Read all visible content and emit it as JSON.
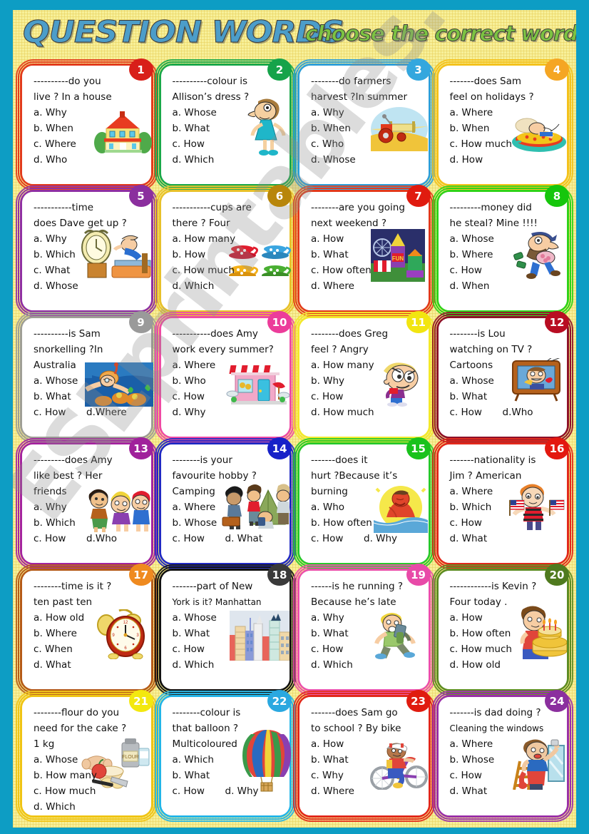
{
  "page": {
    "title_main": "QUESTION WORDS",
    "title_sub": "choose the correct word",
    "watermark": "ESLprintables.com",
    "background_color": "#0d9dc4",
    "sheet_color": "#f7f09a",
    "title_main_color": "#4c9dc9",
    "title_sub_color": "#7cc242"
  },
  "cards": [
    {
      "number": "1",
      "badge_color": "#d81f19",
      "border_color": "#e23a1c",
      "lines": [
        "----------do you",
        "live ?  In a house"
      ],
      "options": [
        "a. Why",
        "b. When",
        "c. Where",
        "d. Who"
      ],
      "art": "house-icon"
    },
    {
      "number": "2",
      "badge_color": "#16a34a",
      "border_color": "#1aa84a",
      "lines": [
        "----------colour is",
        "Allison’s dress ?"
      ],
      "options": [
        "a. Whose",
        "b. What",
        "c. How",
        "d. Which"
      ],
      "art": "woman-dress-icon"
    },
    {
      "number": "3",
      "badge_color": "#34a7de",
      "border_color": "#2f9fd8",
      "lines": [
        "--------do farmers",
        "harvest ?In summer"
      ],
      "options": [
        "a. Why",
        "b. When",
        "c. Who",
        "d. Whose"
      ],
      "art": "tractor-icon"
    },
    {
      "number": "4",
      "badge_color": "#f5a623",
      "border_color": "#f4c21c",
      "lines": [
        "-------does Sam",
        "feel on holidays ?"
      ],
      "options": [
        "a. Where",
        "b. When",
        "c. How much",
        "d. How"
      ],
      "art": "sunbathing-icon"
    },
    {
      "number": "5",
      "badge_color": "#8b2f9e",
      "border_color": "#8f2fa3",
      "lines": [
        "-----------time",
        "does Dave get up ?"
      ],
      "options": [
        "a. Why",
        "b. Which",
        "c. What",
        "d. Whose"
      ],
      "art": "alarm-bed-icon"
    },
    {
      "number": "6",
      "badge_color": "#b8860b",
      "border_color": "#e8c12a",
      "lines": [
        "-----------cups are",
        "there ? Four"
      ],
      "options": [
        "a. How many",
        "b. How",
        "c. How much",
        "d. Which"
      ],
      "art": "cups-icon"
    },
    {
      "number": "7",
      "badge_color": "#e01b0f",
      "border_color": "#e23a1c",
      "lines": [
        "--------are you going",
        "next weekend ?"
      ],
      "options": [
        "a. How",
        "b. What",
        "c. How often",
        "d. Where"
      ],
      "art": "funfair-icon"
    },
    {
      "number": "8",
      "badge_color": "#16c60c",
      "border_color": "#2fd318",
      "lines": [
        "---------money did",
        "he steal? Mine !!!!"
      ],
      "options": [
        "a. Whose",
        "b. Where",
        "c. How",
        "d. When"
      ],
      "art": "thief-icon"
    },
    {
      "number": "9",
      "badge_color": "#9a9a9a",
      "border_color": "#9e9e96",
      "lines": [
        "----------is Sam",
        "snorkelling ?In",
        "Australia"
      ],
      "options": [
        "a. Whose",
        "b. What"
      ],
      "option_pair": [
        "c. How",
        "d.Where"
      ],
      "art": "snorkelling-icon"
    },
    {
      "number": "10",
      "badge_color": "#ec3c9a",
      "border_color": "#ef4aa4",
      "lines": [
        "-----------does Amy",
        "work every summer?"
      ],
      "options": [
        "a. Where",
        "b. Who",
        "c. How",
        "d. Why"
      ],
      "art": "shop-icon"
    },
    {
      "number": "11",
      "badge_color": "#f2e510",
      "border_color": "#f3e92b",
      "lines": [
        "--------does Greg",
        "feel ? Angry"
      ],
      "options": [
        "a. How many",
        "b. Why",
        "c. How",
        "d. How much"
      ],
      "art": "angry-boy-icon"
    },
    {
      "number": "12",
      "badge_color": "#b80d22",
      "border_color": "#8e1028",
      "lines": [
        "--------is Lou",
        "watching on TV ?",
        "Cartoons"
      ],
      "options": [
        "a. Whose",
        "b. What"
      ],
      "option_pair": [
        "c. How",
        "d.Who"
      ],
      "art": "tv-icon"
    },
    {
      "number": "13",
      "badge_color": "#a0219b",
      "border_color": "#a4239f",
      "lines": [
        "---------does Amy",
        "like best ? Her",
        "friends"
      ],
      "options": [
        "a. Why",
        "b. Which"
      ],
      "option_pair": [
        "c. How",
        "d.Who"
      ],
      "art": "friends-icon"
    },
    {
      "number": "14",
      "badge_color": "#1721c8",
      "border_color": "#2029c4",
      "lines": [
        "--------is your",
        "favourite hobby ?",
        "Camping"
      ],
      "options": [
        "a. Where",
        "b. Whose"
      ],
      "option_pair": [
        "c. How",
        "d. What"
      ],
      "art": "camping-icon"
    },
    {
      "number": "15",
      "badge_color": "#19c21c",
      "border_color": "#28c92b",
      "lines": [
        "-------does it",
        "hurt ?Because it’s",
        "burning"
      ],
      "options": [
        "a. Who",
        "b. How often"
      ],
      "option_pair": [
        "c. How",
        "d. Why"
      ],
      "art": "sunburn-icon"
    },
    {
      "number": "16",
      "badge_color": "#e3180f",
      "border_color": "#e2281b",
      "lines": [
        "-------nationality is",
        "Jim ? American"
      ],
      "options": [
        "a. Where",
        "b. Which",
        "c. How",
        "d. What"
      ],
      "art": "flag-boy-icon"
    },
    {
      "number": "17",
      "badge_color": "#ef8a1f",
      "border_color": "#b55a17",
      "lines": [
        "--------time is it ?",
        "ten past ten"
      ],
      "options": [
        "a. How old",
        "b. Where",
        "c. When",
        "d. What"
      ],
      "art": "clock-icon"
    },
    {
      "number": "18",
      "badge_color": "#3a3a3a",
      "border_color": "#111111",
      "lines": [
        "-------part of New"
      ],
      "lines_small": [
        "York  is it? Manhattan"
      ],
      "options": [
        "a. Whose",
        "b. What",
        "c. How",
        "d. Which"
      ],
      "art": "city-icon"
    },
    {
      "number": "19",
      "badge_color": "#e84aa8",
      "border_color": "#ec4fab",
      "lines": [
        "------is he running ?",
        "Because he’s late"
      ],
      "options": [
        "a. Why",
        "b. What",
        "c. How",
        "d. Which"
      ],
      "art": "running-boy-icon"
    },
    {
      "number": "20",
      "badge_color": "#4f7a1e",
      "border_color": "#5d8c22",
      "lines": [
        "------------is Kevin ?",
        "Four today ."
      ],
      "options": [
        "a. How",
        "b. How often",
        "c. How much",
        "d. How old"
      ],
      "art": "birthday-cake-icon"
    },
    {
      "number": "21",
      "badge_color": "#f3e80f",
      "border_color": "#f0c414",
      "lines": [
        "--------flour do you",
        "need for the cake ?",
        "1 kg"
      ],
      "options": [
        "a. Whose",
        "b. How many",
        "c. How much",
        "d. Which"
      ],
      "art": "baking-icon"
    },
    {
      "number": "22",
      "badge_color": "#2aa8e0",
      "border_color": "#22b5e8",
      "lines": [
        "--------colour is",
        "that balloon ?",
        "Multicoloured"
      ],
      "options": [
        "a. Which",
        "b. What"
      ],
      "option_pair": [
        "c. How",
        "d. Why"
      ],
      "art": "balloon-icon"
    },
    {
      "number": "23",
      "badge_color": "#e01b0f",
      "border_color": "#e2281b",
      "lines": [
        "-------does Sam go",
        "to school ? By bike"
      ],
      "options": [
        "a. How",
        "b. What",
        "c. Why",
        "d. Where"
      ],
      "art": "bicycle-icon"
    },
    {
      "number": "24",
      "badge_color": "#8b2f9e",
      "border_color": "#9a2fa8",
      "lines": [
        "-------is dad doing ?"
      ],
      "lines_small": [
        "Cleaning the windows"
      ],
      "options": [
        "a. Where",
        "b. Whose",
        "c. How",
        "d. What"
      ],
      "art": "window-cleaner-icon"
    }
  ]
}
